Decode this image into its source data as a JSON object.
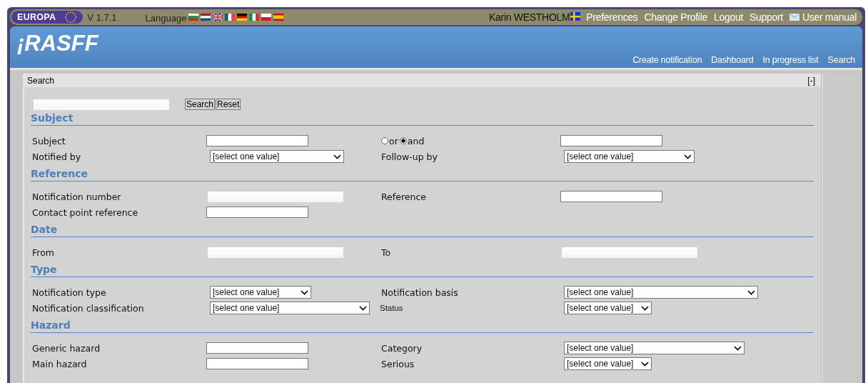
{
  "topbar": {
    "brand": "EUROPA",
    "version": "V 1.7.1",
    "language_label": "Language",
    "user": "Karin WESTHOLM",
    "links": [
      "Preferences",
      "Change Profile",
      "Logout",
      "Support",
      "User manual"
    ]
  },
  "header": {
    "logo": "¡RASFF",
    "nav": [
      "Create notification",
      "Dashboard",
      "In progress list",
      "Search"
    ]
  },
  "panel": {
    "title": "Search",
    "collapse": "[-]",
    "buttons": [
      "Search",
      "Reset"
    ],
    "sections": [
      {
        "title": "Subject",
        "rows": [
          [
            {
              "kind": "label",
              "text": "Subject"
            },
            {
              "kind": "text"
            },
            {
              "kind": "radio",
              "options": [
                {
                  "label": "or",
                  "selected": false
                },
                {
                  "label": "and",
                  "selected": true
                }
              ]
            },
            {
              "kind": "text"
            }
          ],
          [
            {
              "kind": "label",
              "text": "Notified by"
            },
            {
              "kind": "select",
              "value": "[select one value]"
            },
            {
              "kind": "label",
              "text": "Follow-up by"
            },
            {
              "kind": "select",
              "value": "[select one value]"
            }
          ]
        ]
      },
      {
        "title": "Reference",
        "rows": [
          [
            {
              "kind": "label",
              "text": "Notification number"
            },
            {
              "kind": "blank"
            },
            {
              "kind": "label",
              "text": "Reference"
            },
            {
              "kind": "text"
            }
          ],
          [
            {
              "kind": "label",
              "text": "Contact point reference"
            },
            {
              "kind": "text"
            }
          ]
        ]
      },
      {
        "title": "Date",
        "rows": [
          [
            {
              "kind": "label",
              "text": "From"
            },
            {
              "kind": "blank"
            },
            {
              "kind": "label",
              "text": "To"
            },
            {
              "kind": "blank"
            }
          ]
        ]
      },
      {
        "title": "Type",
        "rows": [
          [
            {
              "kind": "label",
              "text": "Notification type"
            },
            {
              "kind": "select",
              "value": "[select one value]"
            },
            {
              "kind": "label",
              "text": "Notification basis"
            },
            {
              "kind": "select",
              "value": "[select one value]"
            }
          ],
          [
            {
              "kind": "label",
              "text": "Notification classification"
            },
            {
              "kind": "select",
              "value": "[select one value]"
            },
            {
              "kind": "small_label",
              "text": "Status"
            },
            {
              "kind": "select",
              "value": "[select one value]"
            }
          ]
        ]
      },
      {
        "title": "Hazard",
        "rows": [
          [
            {
              "kind": "label",
              "text": "Generic hazard"
            },
            {
              "kind": "text"
            },
            {
              "kind": "label",
              "text": "Category"
            },
            {
              "kind": "select",
              "value": "[select one value]"
            }
          ],
          [
            {
              "kind": "label",
              "text": "Main hazard"
            },
            {
              "kind": "text"
            },
            {
              "kind": "label",
              "text": "Serious"
            },
            {
              "kind": "select",
              "value": "[select one value]"
            }
          ]
        ]
      }
    ]
  }
}
